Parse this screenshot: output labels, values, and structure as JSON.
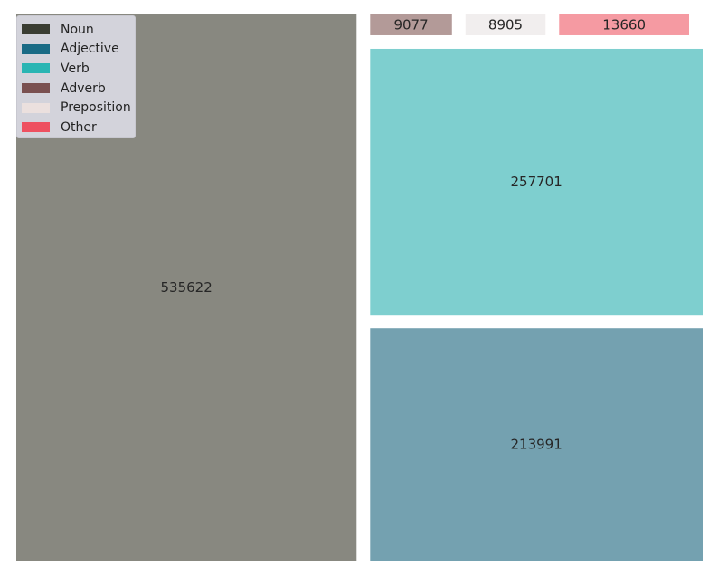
{
  "chart_data": {
    "type": "treemap",
    "title": "",
    "items": [
      {
        "label": "Noun",
        "value": 535622,
        "color": "#3a3d32",
        "fill": "#888880"
      },
      {
        "label": "Adjective",
        "value": 213991,
        "color": "#1a6b85",
        "fill": "#74a1b0"
      },
      {
        "label": "Verb",
        "value": 257701,
        "color": "#2ab5b3",
        "fill": "#7ecfcf"
      },
      {
        "label": "Adverb",
        "value": 9077,
        "color": "#7a5050",
        "fill": "#b39a98"
      },
      {
        "label": "Preposition",
        "value": 8905,
        "color": "#ebe0de",
        "fill": "#f1eeee"
      },
      {
        "label": "Other",
        "value": 13660,
        "color": "#ee5060",
        "fill": "#f59aa2"
      }
    ],
    "legend": {
      "position": "top-left"
    }
  }
}
